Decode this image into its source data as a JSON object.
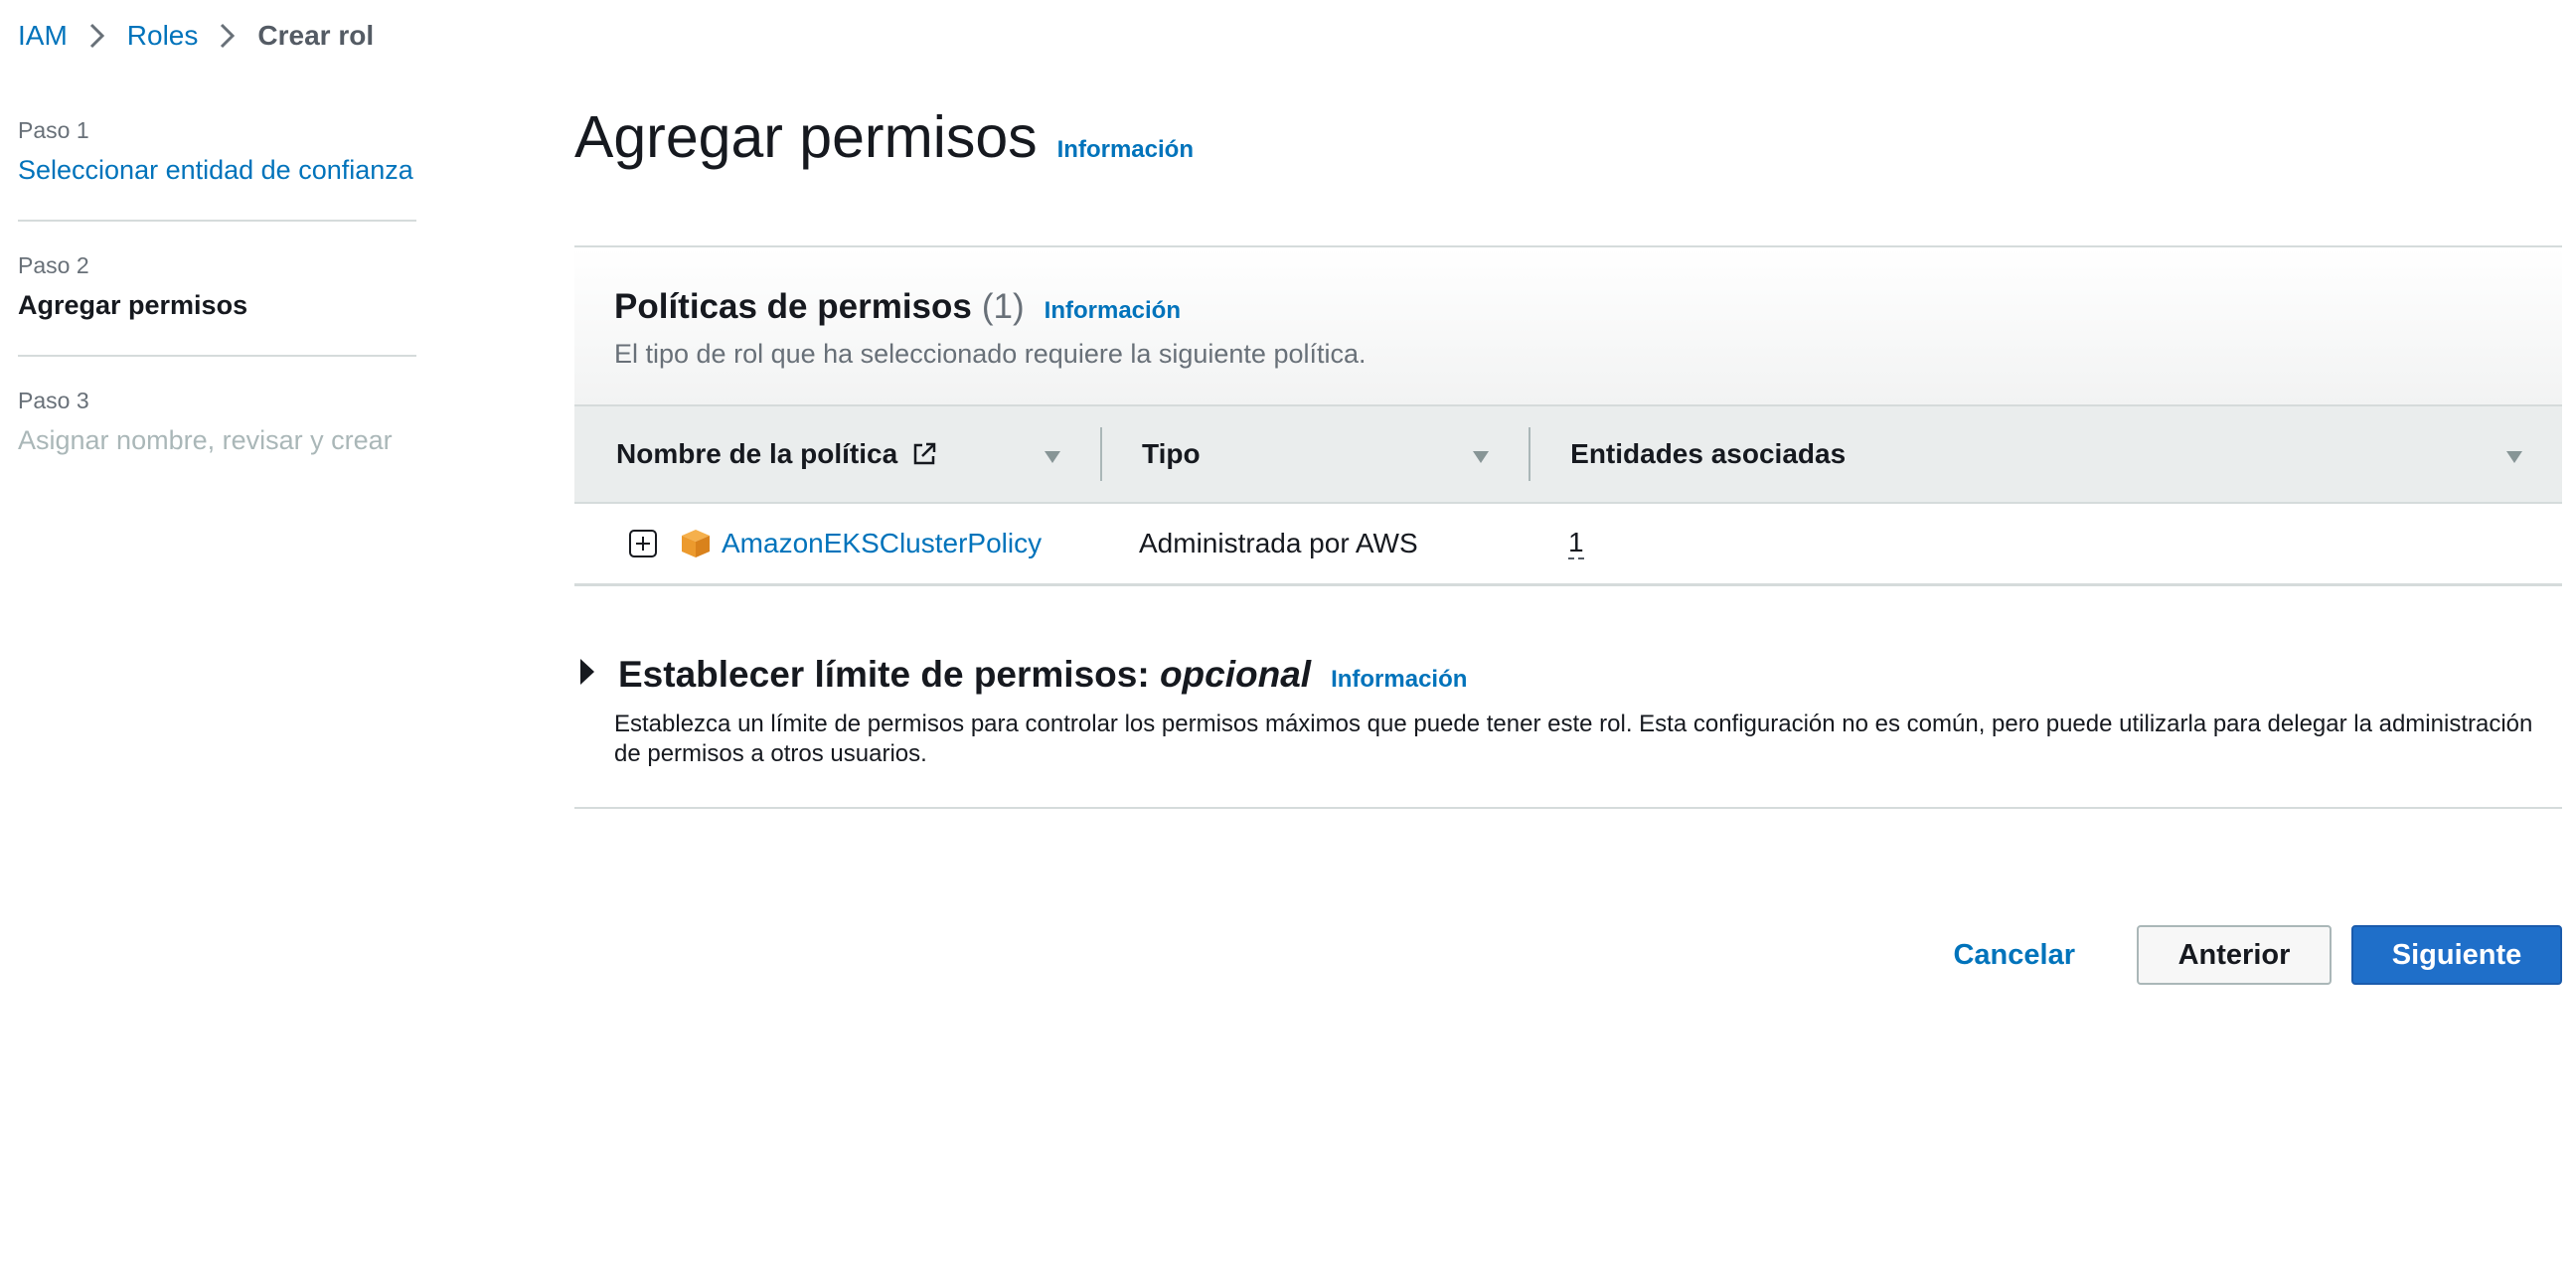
{
  "breadcrumb": {
    "items": [
      "IAM",
      "Roles"
    ],
    "current": "Crear rol"
  },
  "steps": [
    {
      "number": "Paso 1",
      "title": "Seleccionar entidad de confianza",
      "state": "completed"
    },
    {
      "number": "Paso 2",
      "title": "Agregar permisos",
      "state": "current"
    },
    {
      "number": "Paso 3",
      "title": "Asignar nombre, revisar y crear",
      "state": "disabled"
    }
  ],
  "page": {
    "title": "Agregar permisos",
    "info_link": "Información"
  },
  "policies": {
    "title": "Políticas de permisos",
    "count": "(1)",
    "info_link": "Información",
    "description": "El tipo de rol que ha seleccionado requiere la siguiente política.",
    "columns": [
      "Nombre de la política",
      "Tipo",
      "Entidades asociadas"
    ],
    "rows": [
      {
        "name": "AmazonEKSClusterPolicy",
        "type": "Administrada por AWS",
        "entities": "1"
      }
    ]
  },
  "boundary": {
    "title": "Establecer límite de permisos:",
    "title_optional": "opcional",
    "info_link": "Información",
    "description": "Establezca un límite de permisos para controlar los permisos máximos que puede tener este rol. Esta configuración no es común, pero puede utilizarla para delegar la administración de permisos a otros usuarios."
  },
  "actions": {
    "cancel": "Cancelar",
    "previous": "Anterior",
    "next": "Siguiente"
  },
  "colors": {
    "link": "#0073bb",
    "primary_button": "#1f6fc9",
    "policy_icon": "#ec9a2d"
  }
}
